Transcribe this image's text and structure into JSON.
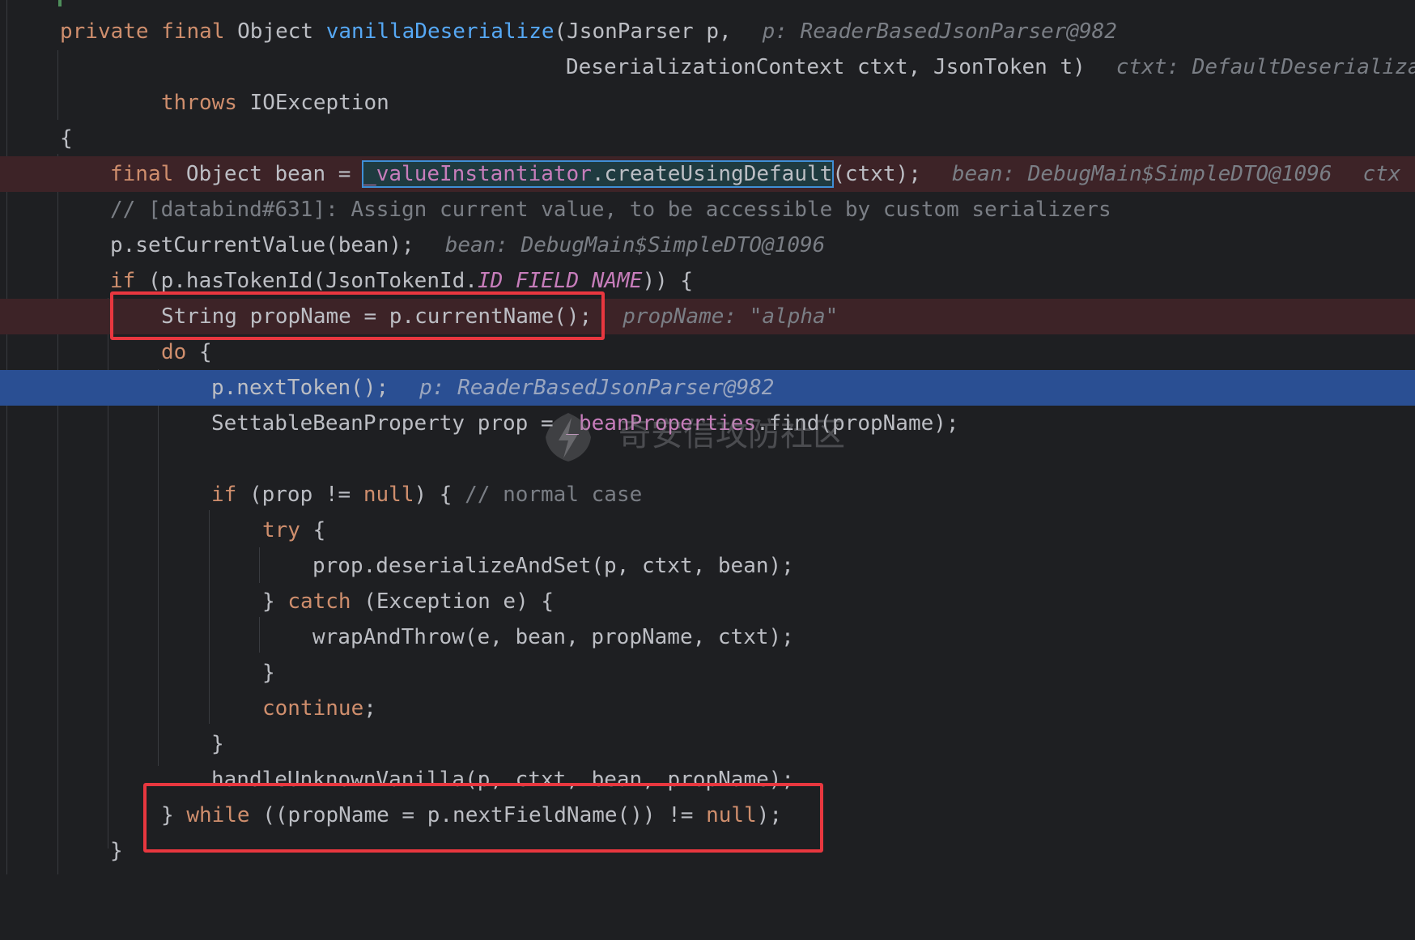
{
  "editor": {
    "l1": {
      "kw": "private final",
      "sp1": " Object ",
      "fn": "vanillaDeserialize",
      "rest": "(JsonParser p,",
      "hint": "p: ReaderBasedJsonParser@982"
    },
    "l2": {
      "text": "DeserializationContext ctxt, JsonToken t)",
      "hint": "ctxt: DefaultDeserializa"
    },
    "l3": {
      "kw": "throws",
      "rest": " IOException"
    },
    "l4": {
      "text": "{"
    },
    "l5": {
      "kw": "final",
      "mid": " Object bean = ",
      "sel_field": "_valueInstantiator",
      "sel_rest": ".createUsingDefault",
      "rest": "(ctxt);",
      "hint": "bean: DebugMain$SimpleDTO@1096",
      "hint2": "ctx"
    },
    "l6": {
      "text": "// [databind#631]: Assign current value, to be accessible by custom serializers"
    },
    "l7": {
      "text": "p.setCurrentValue(bean);",
      "hint": "bean: DebugMain$SimpleDTO@1096"
    },
    "l8": {
      "kw": "if",
      "pre": " (p.hasTokenId(JsonTokenId.",
      "const": "ID_FIELD_NAME",
      "rest": ")) {"
    },
    "l9": {
      "text": "String propName = p.currentName();",
      "hint": "propName: \"alpha\""
    },
    "l10": {
      "kw": "do",
      "rest": " {"
    },
    "l11": {
      "text": "p.nextToken();",
      "hint": "p: ReaderBasedJsonParser@982"
    },
    "l12": {
      "pre": "SettableBeanProperty prop = ",
      "fld": "_beanProperties",
      "rest": ".find(propName);"
    },
    "l14": {
      "kw": "if",
      "pre": " (prop != ",
      "kw2": "null",
      "rest": ") { ",
      "cmt": "// normal case"
    },
    "l15": {
      "kw": "try",
      "rest": " {"
    },
    "l16": {
      "text": "prop.deserializeAndSet(p, ctxt, bean);"
    },
    "l17": {
      "pre": "} ",
      "kw": "catch",
      "rest": " (Exception e) {"
    },
    "l18": {
      "text": "wrapAndThrow(e, bean, propName, ctxt);"
    },
    "l19": {
      "text": "}"
    },
    "l20": {
      "kw": "continue",
      "rest": ";"
    },
    "l21": {
      "text": "}"
    },
    "l22": {
      "text": "handleUnknownVanilla(p, ctxt, bean, propName);"
    },
    "l23": {
      "pre": "} ",
      "kw": "while",
      "mid": " ((propName = p.nextFieldName()) != ",
      "kw2": "null",
      "rest": ");"
    },
    "l24": {
      "text": "}"
    }
  },
  "watermark": {
    "text": "奇安信攻防社区"
  },
  "colors": {
    "background": "#1e1f22",
    "breakpoint_line": "#3d2327",
    "current_line": "#2a4f93",
    "keyword": "#cf8e6d",
    "method": "#56a8f5",
    "field": "#c77dbb",
    "comment": "#7a7e85",
    "highlight_box": "#e8373f"
  }
}
